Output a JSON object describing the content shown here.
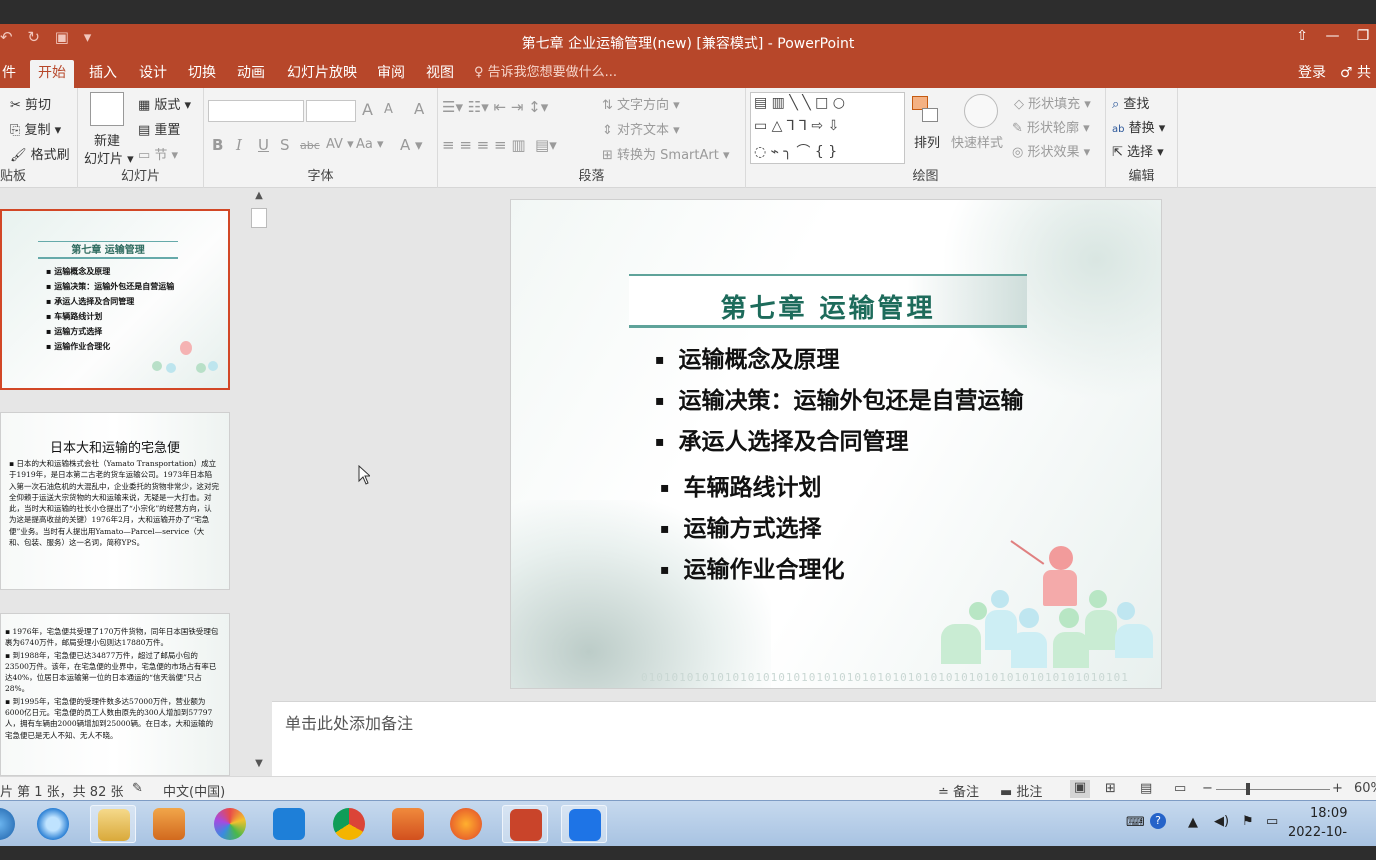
{
  "window": {
    "title": "第七章 企业运输管理(new) [兼容模式] - PowerPoint"
  },
  "qat": {
    "undo": "↶",
    "redo": "↻",
    "present": "▣",
    "more": "▾"
  },
  "tabs": [
    {
      "label": "件"
    },
    {
      "label": "开始"
    },
    {
      "label": "插入"
    },
    {
      "label": "设计"
    },
    {
      "label": "切换"
    },
    {
      "label": "动画"
    },
    {
      "label": "幻灯片放映"
    },
    {
      "label": "审阅"
    },
    {
      "label": "视图"
    }
  ],
  "tellme": "♀ 告诉我您想要做什么...",
  "account": {
    "login": "登录",
    "share": "♂ 共"
  },
  "ribbon": {
    "clipboard": {
      "cut": "✂ 剪切",
      "copy": "⎘ 复制 ▾",
      "format_painter": "🖌 格式刷",
      "label": "贴板"
    },
    "slides": {
      "new_slide_top": "新建",
      "new_slide_bottom": "幻灯片 ▾",
      "layout": "版式 ▾",
      "reset": "重置",
      "section": "节 ▾",
      "label": "幻灯片"
    },
    "font": {
      "bold": "B",
      "italic": "I",
      "underline": "U",
      "strike": "S",
      "abc": "abc",
      "spacing": "AV ▾",
      "case": "Aa ▾",
      "color": "A ▾",
      "grow": "A",
      "shrink": "A",
      "clear": "A",
      "label": "字体"
    },
    "paragraph": {
      "text_direction": "文字方向 ▾",
      "align_text": "对齐文本 ▾",
      "smartart": "转换为 SmartArt ▾",
      "label": "段落"
    },
    "drawing": {
      "arrange": "排列",
      "quick_styles": "快速样式",
      "shape_fill": "形状填充 ▾",
      "shape_outline": "形状轮廓 ▾",
      "shape_effects": "形状效果 ▾",
      "label": "绘图"
    },
    "editing": {
      "find": "查找",
      "replace": "替换 ▾",
      "select": "选择 ▾",
      "label": "编辑"
    }
  },
  "thumbnails": {
    "t1": {
      "title": "第七章  运输管理",
      "items": [
        "运输概念及原理",
        "运输决策：运输外包还是自营运输",
        "承运人选择及合同管理",
        "车辆路线计划",
        "运输方式选择",
        "运输作业合理化"
      ]
    },
    "t2": {
      "title": "日本大和运输的宅急便",
      "body": "▪ 日本的大和运输株式会社（Yamato Transportation）成立于1919年，是日本第二古老的货车运输公司。1973年日本陷入第一次石油危机的大混乱中，企业委托的货物非常少，这对完全仰赖于运送大宗货物的大和运输来说，无疑是一大打击。对此，当时大和运输的社长小仓提出了“小宗化”的经营方向，认为这是提高收益的关键）1976年2月，大和运输开办了“宅急便”业务。当时有人提出用Yamato—Parcel—service（大和、包装、服务）这一名词，简称YPS。"
    },
    "t3": {
      "p1": "▪ 1976年，宅急便共受理了170万件货物，同年日本国铁受理包裹为6740万件，邮局受理小包则达17880万件。",
      "p2": "▪ 到1988年，宅急便已达34877万件，超过了邮局小包的23500万件。该年，在宅急便的业界中，宅急便的市场占有率已达40%，位居日本运输第一位的日本通运的“信天翁便”只占28%。",
      "p3": "▪ 到1995年，宅急便的受理件数多达57000万件，营业额为6000亿日元。宅急便的员工人数由原先的300人增加到57797人，拥有车辆由2000辆增加到25000辆。在日本，大和运输的宅急便已是无人不知、无人不晓。"
    }
  },
  "slide": {
    "heading": "第七章  运输管理",
    "bullets_a": [
      "运输概念及原理",
      "运输决策：运输外包还是自营运输",
      "承运人选择及合同管理"
    ],
    "bullets_b": [
      "车辆路线计划",
      "运输方式选择",
      "运输作业合理化"
    ],
    "binary": "0101010101010101010101010101010101010101010101010101010101010101"
  },
  "notes": {
    "placeholder": "单击此处添加备注"
  },
  "status": {
    "slide_info": "片 第 1 张，共 82 张",
    "language": "中文(中国)",
    "notes": "≐ 备注",
    "comments": "▬ 批注",
    "zoom": "60%"
  },
  "tray": {
    "time": "18:09",
    "date": "2022-10-"
  },
  "colors": {
    "accent": "#b7472a",
    "slide_heading": "#1d6b5b"
  }
}
